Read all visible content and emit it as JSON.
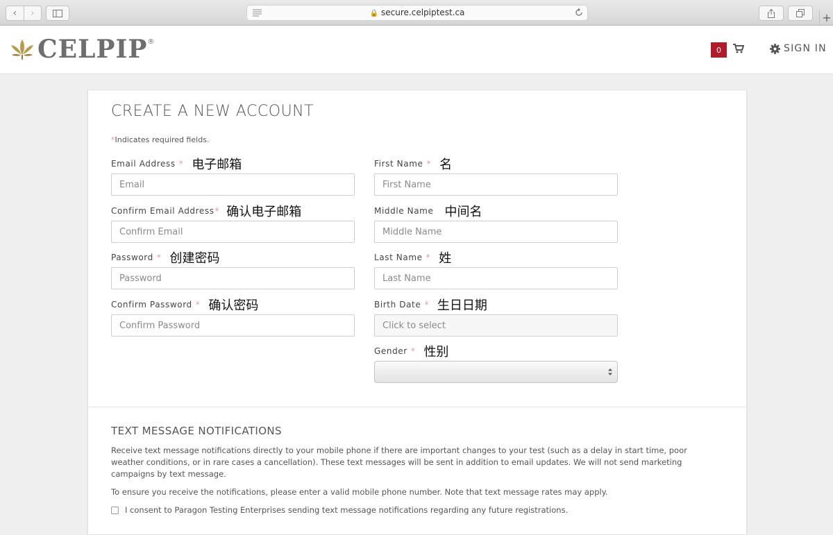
{
  "browser": {
    "url": "secure.celpiptest.ca",
    "back_glyph": "‹",
    "forward_glyph": "›",
    "new_tab_glyph": "+"
  },
  "header": {
    "logo_text": "CELPIP",
    "logo_reg": "®",
    "cart_count": "0",
    "sign_in": "SIGN IN"
  },
  "colors": {
    "brand_red": "#b01c2e",
    "required_star": "#f0959e",
    "logo_gold": "#b89a4a",
    "logo_grey": "#6e6d6f"
  },
  "form": {
    "title": "CREATE A NEW ACCOUNT",
    "required_marker": "*",
    "required_note": "Indicates required fields.",
    "fields": {
      "email": {
        "label": "Email Address",
        "annotation": "电子邮箱",
        "placeholder": "Email"
      },
      "confirm_email": {
        "label": "Confirm Email Address",
        "annotation": "确认电子邮箱",
        "placeholder": "Confirm Email"
      },
      "password": {
        "label": "Password",
        "annotation": "创建密码",
        "placeholder": "Password"
      },
      "confirm_password": {
        "label": "Confirm Password",
        "annotation": "确认密码",
        "placeholder": "Confirm Password"
      },
      "first_name": {
        "label": "First Name",
        "annotation": "名",
        "placeholder": "First Name"
      },
      "middle_name": {
        "label": "Middle Name",
        "annotation": "中间名",
        "placeholder": "Middle Name"
      },
      "last_name": {
        "label": "Last Name",
        "annotation": "姓",
        "placeholder": "Last Name"
      },
      "birth_date": {
        "label": "Birth Date",
        "annotation": "生日日期",
        "placeholder": "Click to select"
      },
      "gender": {
        "label": "Gender",
        "annotation": "性别",
        "selected": ""
      }
    }
  },
  "sms": {
    "title": "TEXT MESSAGE NOTIFICATIONS",
    "description": "Receive text message notifications directly to your mobile phone if there are important changes to your test (such as a delay in start time, poor weather conditions, or in rare cases a cancellation). These text messages will be sent in addition to email updates. We will not send marketing campaigns by text message.",
    "note": "To ensure you receive the notifications, please enter a valid mobile phone number. Note that text message rates may apply.",
    "consent_label": "I consent to Paragon Testing Enterprises sending text message notifications regarding any future registrations."
  }
}
